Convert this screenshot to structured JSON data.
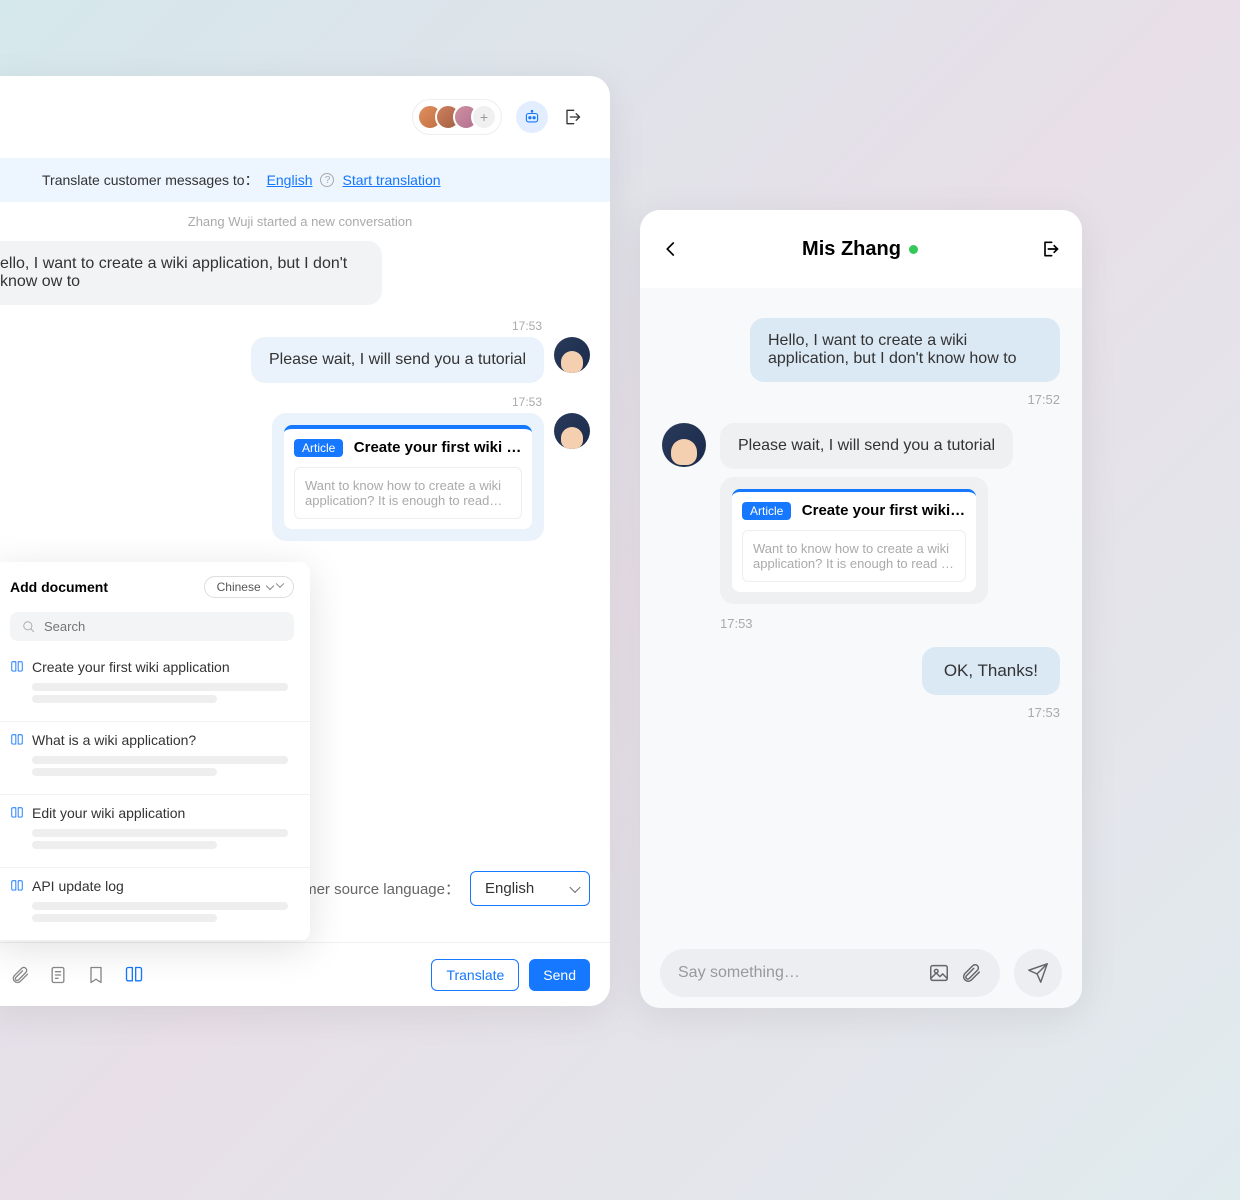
{
  "left": {
    "translate_label": "Translate customer messages to：",
    "translate_lang": "English",
    "start_translation": "Start translation",
    "conv_start": "Zhang Wuji started a new conversation",
    "msg1": "ello, I want to create a wiki application, but I don't know ow to",
    "msg2_time": "17:53",
    "msg2": "Please wait, I will send you a tutorial",
    "msg3_time": "17:53",
    "article_badge": "Article",
    "article_title": "Create your first wiki …",
    "article_body": "Want to know how to create a wiki application? It is enough to read…",
    "source_lang_label": "omer source language：",
    "source_lang_value": "English",
    "translate_btn": "Translate",
    "send_btn": "Send"
  },
  "doc": {
    "title": "Add document",
    "lang": "Chinese",
    "search_placeholder": "Search",
    "items": [
      "Create your first wiki application",
      "What is a wiki application?",
      "Edit your wiki application",
      "API update log"
    ]
  },
  "right": {
    "title": "Mis Zhang",
    "msg1": "Hello, I want to create a wiki application, but I don't know how to",
    "msg1_time": "17:52",
    "msg2": "Please wait, I will send you a tutorial",
    "article_badge": "Article",
    "article_title": "Create your first wiki…",
    "article_body": "Want to know how to create a wiki application? It is enough to read …",
    "msg2_time": "17:53",
    "msg3": "OK, Thanks!",
    "msg3_time": "17:53",
    "input_placeholder": "Say something…"
  }
}
